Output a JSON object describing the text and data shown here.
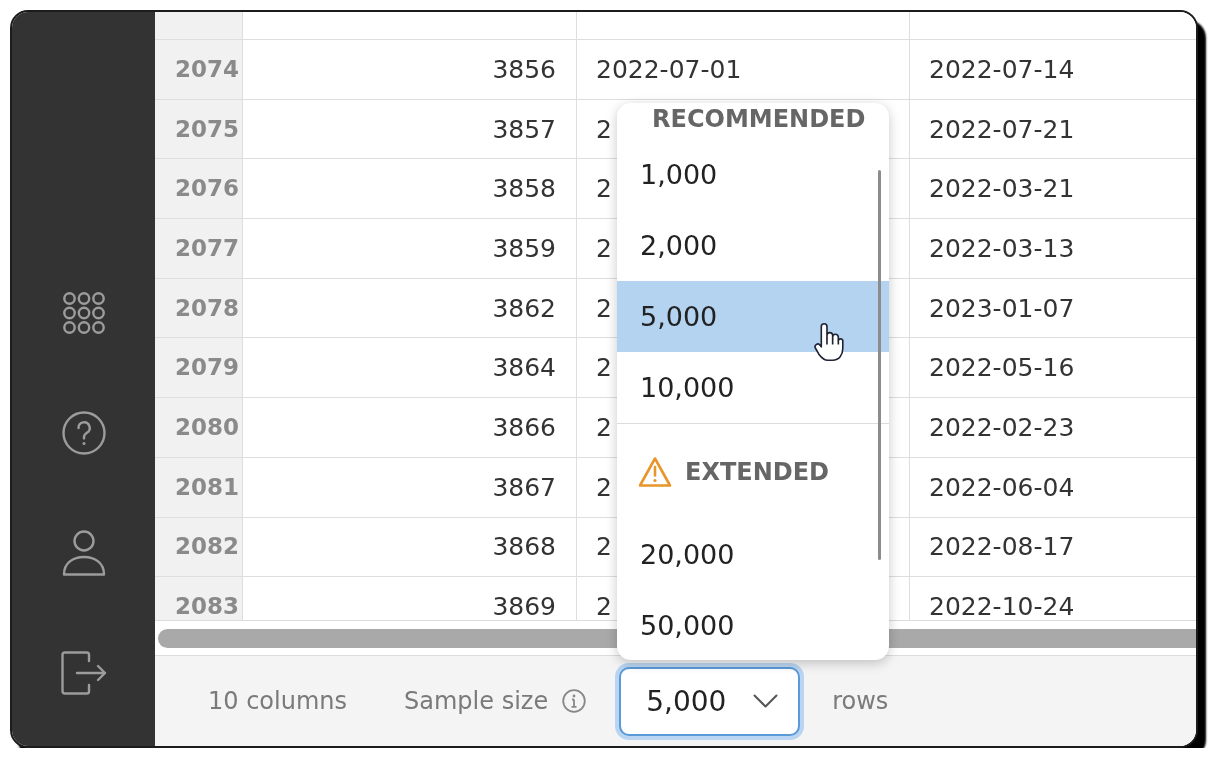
{
  "sidebar": {
    "items": [
      {
        "kind": "apps"
      },
      {
        "kind": "help"
      },
      {
        "kind": "profile"
      },
      {
        "kind": "logout"
      }
    ]
  },
  "table": {
    "rows": [
      {
        "number": "2074",
        "cells": [
          "3856",
          "2022-07-01",
          "2022-07-14"
        ]
      },
      {
        "number": "2075",
        "cells": [
          "3857",
          "2",
          "2022-07-21"
        ]
      },
      {
        "number": "2076",
        "cells": [
          "3858",
          "2",
          "2022-03-21"
        ]
      },
      {
        "number": "2077",
        "cells": [
          "3859",
          "2",
          "2022-03-13"
        ]
      },
      {
        "number": "2078",
        "cells": [
          "3862",
          "2",
          "2023-01-07"
        ]
      },
      {
        "number": "2079",
        "cells": [
          "3864",
          "2",
          "2022-05-16"
        ]
      },
      {
        "number": "2080",
        "cells": [
          "3866",
          "2",
          "2022-02-23"
        ]
      },
      {
        "number": "2081",
        "cells": [
          "3867",
          "2",
          "2022-06-04"
        ]
      },
      {
        "number": "2082",
        "cells": [
          "3868",
          "2",
          "2022-08-17"
        ]
      },
      {
        "number": "2083",
        "cells": [
          "3869",
          "2",
          "2022-10-24"
        ]
      }
    ]
  },
  "sample_size_menu": {
    "groups": [
      {
        "header": "RECOMMENDED",
        "warning": false,
        "options": [
          {
            "label": "1,000",
            "selected": false
          },
          {
            "label": "2,000",
            "selected": false
          },
          {
            "label": "5,000",
            "selected": true
          },
          {
            "label": "10,000",
            "selected": false
          }
        ]
      },
      {
        "header": "EXTENDED",
        "warning": true,
        "options": [
          {
            "label": "20,000",
            "selected": false
          },
          {
            "label": "50,000",
            "selected": false
          }
        ]
      }
    ]
  },
  "footer": {
    "column_count": "10 columns",
    "sample_size_label": "Sample size",
    "sample_size_select": {
      "value": "5,000",
      "open": true
    },
    "unit": "rows"
  }
}
